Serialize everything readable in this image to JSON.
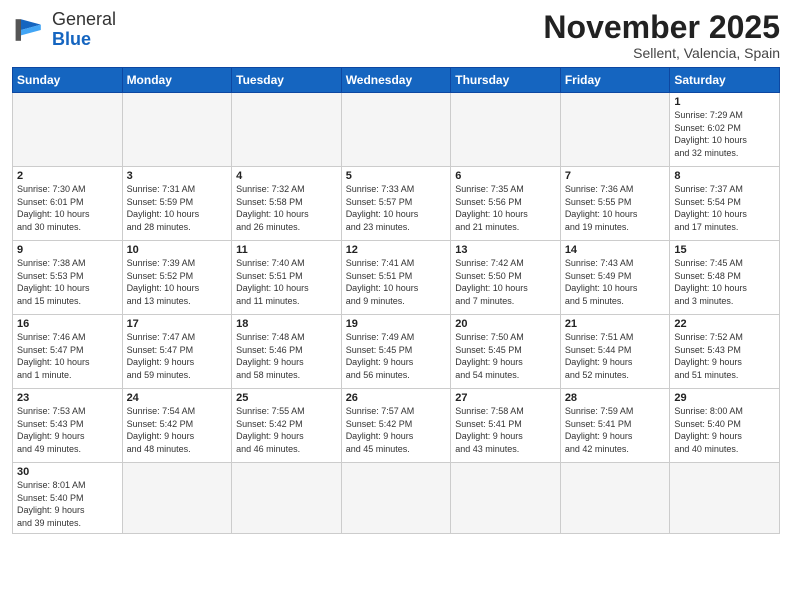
{
  "header": {
    "logo_general": "General",
    "logo_blue": "Blue",
    "month_title": "November 2025",
    "subtitle": "Sellent, Valencia, Spain"
  },
  "days_of_week": [
    "Sunday",
    "Monday",
    "Tuesday",
    "Wednesday",
    "Thursday",
    "Friday",
    "Saturday"
  ],
  "weeks": [
    [
      {
        "day": "",
        "info": ""
      },
      {
        "day": "",
        "info": ""
      },
      {
        "day": "",
        "info": ""
      },
      {
        "day": "",
        "info": ""
      },
      {
        "day": "",
        "info": ""
      },
      {
        "day": "",
        "info": ""
      },
      {
        "day": "1",
        "info": "Sunrise: 7:29 AM\nSunset: 6:02 PM\nDaylight: 10 hours\nand 32 minutes."
      }
    ],
    [
      {
        "day": "2",
        "info": "Sunrise: 7:30 AM\nSunset: 6:01 PM\nDaylight: 10 hours\nand 30 minutes."
      },
      {
        "day": "3",
        "info": "Sunrise: 7:31 AM\nSunset: 5:59 PM\nDaylight: 10 hours\nand 28 minutes."
      },
      {
        "day": "4",
        "info": "Sunrise: 7:32 AM\nSunset: 5:58 PM\nDaylight: 10 hours\nand 26 minutes."
      },
      {
        "day": "5",
        "info": "Sunrise: 7:33 AM\nSunset: 5:57 PM\nDaylight: 10 hours\nand 23 minutes."
      },
      {
        "day": "6",
        "info": "Sunrise: 7:35 AM\nSunset: 5:56 PM\nDaylight: 10 hours\nand 21 minutes."
      },
      {
        "day": "7",
        "info": "Sunrise: 7:36 AM\nSunset: 5:55 PM\nDaylight: 10 hours\nand 19 minutes."
      },
      {
        "day": "8",
        "info": "Sunrise: 7:37 AM\nSunset: 5:54 PM\nDaylight: 10 hours\nand 17 minutes."
      }
    ],
    [
      {
        "day": "9",
        "info": "Sunrise: 7:38 AM\nSunset: 5:53 PM\nDaylight: 10 hours\nand 15 minutes."
      },
      {
        "day": "10",
        "info": "Sunrise: 7:39 AM\nSunset: 5:52 PM\nDaylight: 10 hours\nand 13 minutes."
      },
      {
        "day": "11",
        "info": "Sunrise: 7:40 AM\nSunset: 5:51 PM\nDaylight: 10 hours\nand 11 minutes."
      },
      {
        "day": "12",
        "info": "Sunrise: 7:41 AM\nSunset: 5:51 PM\nDaylight: 10 hours\nand 9 minutes."
      },
      {
        "day": "13",
        "info": "Sunrise: 7:42 AM\nSunset: 5:50 PM\nDaylight: 10 hours\nand 7 minutes."
      },
      {
        "day": "14",
        "info": "Sunrise: 7:43 AM\nSunset: 5:49 PM\nDaylight: 10 hours\nand 5 minutes."
      },
      {
        "day": "15",
        "info": "Sunrise: 7:45 AM\nSunset: 5:48 PM\nDaylight: 10 hours\nand 3 minutes."
      }
    ],
    [
      {
        "day": "16",
        "info": "Sunrise: 7:46 AM\nSunset: 5:47 PM\nDaylight: 10 hours\nand 1 minute."
      },
      {
        "day": "17",
        "info": "Sunrise: 7:47 AM\nSunset: 5:47 PM\nDaylight: 9 hours\nand 59 minutes."
      },
      {
        "day": "18",
        "info": "Sunrise: 7:48 AM\nSunset: 5:46 PM\nDaylight: 9 hours\nand 58 minutes."
      },
      {
        "day": "19",
        "info": "Sunrise: 7:49 AM\nSunset: 5:45 PM\nDaylight: 9 hours\nand 56 minutes."
      },
      {
        "day": "20",
        "info": "Sunrise: 7:50 AM\nSunset: 5:45 PM\nDaylight: 9 hours\nand 54 minutes."
      },
      {
        "day": "21",
        "info": "Sunrise: 7:51 AM\nSunset: 5:44 PM\nDaylight: 9 hours\nand 52 minutes."
      },
      {
        "day": "22",
        "info": "Sunrise: 7:52 AM\nSunset: 5:43 PM\nDaylight: 9 hours\nand 51 minutes."
      }
    ],
    [
      {
        "day": "23",
        "info": "Sunrise: 7:53 AM\nSunset: 5:43 PM\nDaylight: 9 hours\nand 49 minutes."
      },
      {
        "day": "24",
        "info": "Sunrise: 7:54 AM\nSunset: 5:42 PM\nDaylight: 9 hours\nand 48 minutes."
      },
      {
        "day": "25",
        "info": "Sunrise: 7:55 AM\nSunset: 5:42 PM\nDaylight: 9 hours\nand 46 minutes."
      },
      {
        "day": "26",
        "info": "Sunrise: 7:57 AM\nSunset: 5:42 PM\nDaylight: 9 hours\nand 45 minutes."
      },
      {
        "day": "27",
        "info": "Sunrise: 7:58 AM\nSunset: 5:41 PM\nDaylight: 9 hours\nand 43 minutes."
      },
      {
        "day": "28",
        "info": "Sunrise: 7:59 AM\nSunset: 5:41 PM\nDaylight: 9 hours\nand 42 minutes."
      },
      {
        "day": "29",
        "info": "Sunrise: 8:00 AM\nSunset: 5:40 PM\nDaylight: 9 hours\nand 40 minutes."
      }
    ],
    [
      {
        "day": "30",
        "info": "Sunrise: 8:01 AM\nSunset: 5:40 PM\nDaylight: 9 hours\nand 39 minutes."
      },
      {
        "day": "",
        "info": ""
      },
      {
        "day": "",
        "info": ""
      },
      {
        "day": "",
        "info": ""
      },
      {
        "day": "",
        "info": ""
      },
      {
        "day": "",
        "info": ""
      },
      {
        "day": "",
        "info": ""
      }
    ]
  ]
}
